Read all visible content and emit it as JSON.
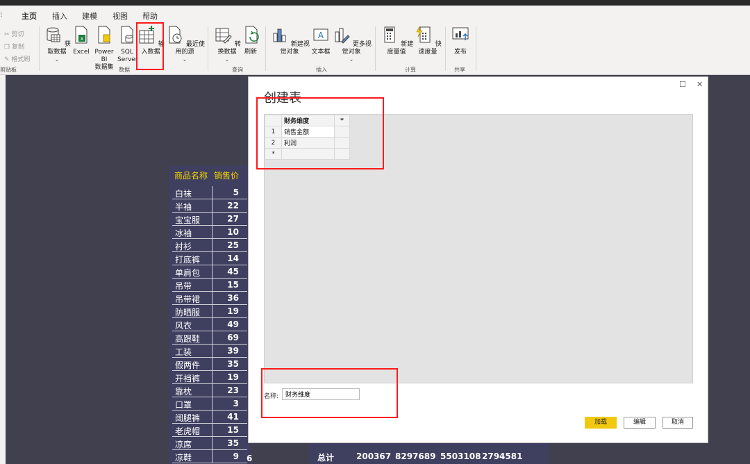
{
  "menu_tabs": [
    {
      "label": "主页",
      "active": true
    },
    {
      "label": "插入",
      "active": false
    },
    {
      "label": "建模",
      "active": false
    },
    {
      "label": "视图",
      "active": false
    },
    {
      "label": "帮助",
      "active": false
    }
  ],
  "clipboard": {
    "cut": "剪切",
    "copy": "复制",
    "format_painter": "格式刷",
    "group": "剪贴板"
  },
  "ribbon": {
    "get_data": "获取数据",
    "excel": "Excel",
    "powerbi_line1": "Power BI",
    "powerbi_line2": "数据集",
    "sql_line1": "SQL",
    "sql_line2": "Server",
    "enter_data": "输入数据",
    "recent_sources": "最近使用的源",
    "group_data": "数据",
    "transform": "转换数据",
    "refresh": "刷新",
    "group_query": "查询",
    "new_visual": "新建视觉对象",
    "textbox": "文本框",
    "more_visuals": "更多视觉对象",
    "group_insert": "插入",
    "new_measure": "新建度量值",
    "quick_measure": "快速度量",
    "group_calc": "计算",
    "publish": "发布",
    "group_share": "共享"
  },
  "background_table": {
    "headers": [
      "商品名称",
      "销售价"
    ],
    "rows": [
      {
        "name": "白袜",
        "value": "5"
      },
      {
        "name": "半袖",
        "value": "22"
      },
      {
        "name": "宝宝服",
        "value": "27"
      },
      {
        "name": "冰袖",
        "value": "10"
      },
      {
        "name": "衬衫",
        "value": "25"
      },
      {
        "name": "打底裤",
        "value": "14"
      },
      {
        "name": "单肩包",
        "value": "45"
      },
      {
        "name": "吊带",
        "value": "15"
      },
      {
        "name": "吊带裙",
        "value": "36"
      },
      {
        "name": "防晒服",
        "value": "19"
      },
      {
        "name": "风衣",
        "value": "49"
      },
      {
        "name": "高跟鞋",
        "value": "69"
      },
      {
        "name": "工装",
        "value": "39"
      },
      {
        "name": "假两件",
        "value": "35"
      },
      {
        "name": "开裆裤",
        "value": "19"
      },
      {
        "name": "靠枕",
        "value": "23"
      },
      {
        "name": "口罩",
        "value": "3"
      },
      {
        "name": "阔腿裤",
        "value": "41"
      },
      {
        "name": "老虎帽",
        "value": "15"
      },
      {
        "name": "凉席",
        "value": "35"
      },
      {
        "name": "凉鞋",
        "value": "9"
      }
    ],
    "extra_col_last": "6"
  },
  "summary_table": {
    "label": "总计",
    "values": [
      "200367",
      "8297689",
      "5503108",
      "2794581"
    ]
  },
  "dialog": {
    "title": "创建表",
    "grid": {
      "column_header": "财务维度",
      "add_column": "*",
      "rows": [
        {
          "num": "1",
          "value": "销售金额"
        },
        {
          "num": "2",
          "value": "利润"
        }
      ],
      "new_row_marker": "*"
    },
    "name_label": "名称:",
    "name_value": "财务维度",
    "load_button": "加载",
    "edit_button": "编辑",
    "cancel_button": "取消",
    "maximize": "☐",
    "close": "✕"
  },
  "colors": {
    "accent": "#f2c811",
    "highlight_box": "#ff1a1a",
    "canvas": "#40404f",
    "table_header_text": "#f5d400"
  }
}
